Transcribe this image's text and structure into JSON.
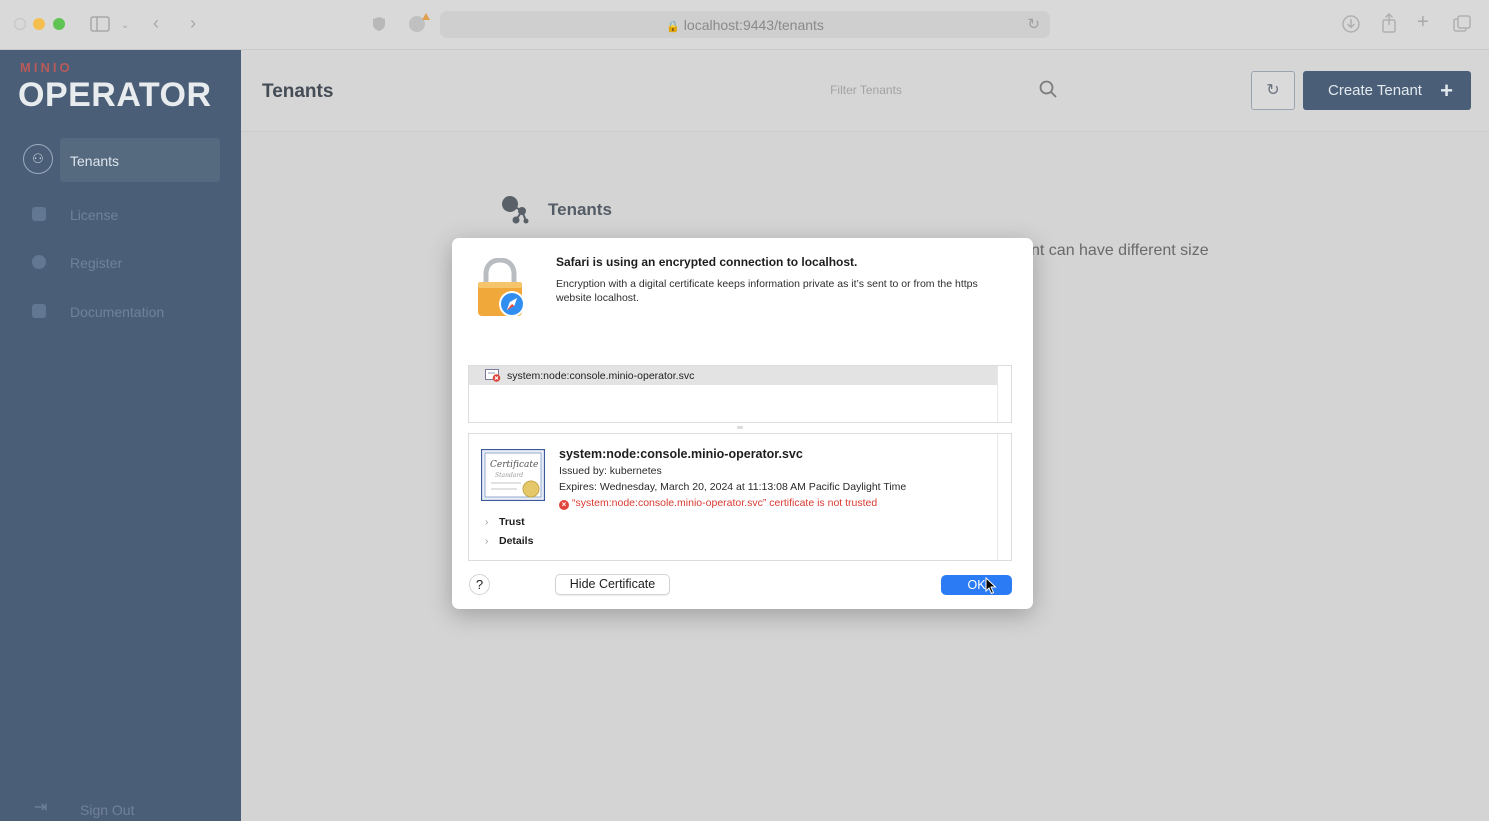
{
  "browser": {
    "url": "localhost:9443/tenants",
    "icons": [
      "sidebar-toggle-icon",
      "chevron-down-icon",
      "back-icon",
      "forward-icon",
      "shield-icon",
      "extension-icon",
      "lock-icon",
      "reload-icon",
      "download-icon",
      "share-icon",
      "new-tab-icon",
      "tabs-overview-icon"
    ]
  },
  "sidebar": {
    "brand_small": "MINIO",
    "brand_big": "OPERATOR",
    "items": [
      {
        "label": "Tenants",
        "icon": "tenants-icon",
        "active": true
      },
      {
        "label": "License",
        "icon": "license-icon",
        "active": false
      },
      {
        "label": "Register",
        "icon": "register-icon",
        "active": false
      },
      {
        "label": "Documentation",
        "icon": "documentation-icon",
        "active": false
      }
    ],
    "sign_out": "Sign Out"
  },
  "header": {
    "title": "Tenants",
    "filter_placeholder": "Filter Tenants",
    "create_button": "Create Tenant"
  },
  "content": {
    "card_title": "Tenants",
    "card_description": "nt can have different size"
  },
  "dialog": {
    "title": "Safari is using an encrypted connection to localhost.",
    "body": "Encryption with a digital certificate keeps information private as it’s sent to or from the https website localhost.",
    "cert_list_item": "system:node:console.minio-operator.svc",
    "cert_name": "system:node:console.minio-operator.svc",
    "issued_by": "Issued by: kubernetes",
    "expires": "Expires: Wednesday, March 20, 2024 at 11:13:08 AM Pacific Daylight Time",
    "error": "“system:node:console.minio-operator.svc” certificate is not trusted",
    "sections": [
      "Trust",
      "Details"
    ],
    "help_label": "?",
    "hide_button": "Hide Certificate",
    "ok_button": "OK"
  },
  "colors": {
    "sidebar_bg": "#4a5f77",
    "ok_button": "#2b7cf4",
    "error_text": "#d93a31"
  }
}
